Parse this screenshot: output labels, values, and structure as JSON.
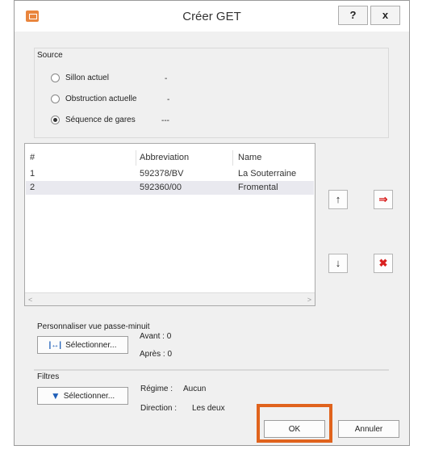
{
  "window": {
    "title": "Créer GET",
    "help_label": "?",
    "close_label": "x"
  },
  "source": {
    "label": "Source",
    "options": [
      {
        "label": "Sillon actuel",
        "value": "-",
        "selected": false
      },
      {
        "label": "Obstruction actuelle",
        "value": "-",
        "selected": false
      },
      {
        "label": "Séquence de gares",
        "value": "---",
        "selected": true
      }
    ]
  },
  "table": {
    "columns": [
      "#",
      "Abbreviation",
      "Name"
    ],
    "rows": [
      {
        "num": "1",
        "abbr": "592378/BV",
        "name": "La Souterraine",
        "selected": false
      },
      {
        "num": "2",
        "abbr": "592360/00",
        "name": "Fromental",
        "selected": true
      }
    ],
    "scroll_left": "<",
    "scroll_right": ">"
  },
  "side_buttons": {
    "up": "↑",
    "down": "↓",
    "insert": "⇒",
    "delete": "✖"
  },
  "passe_minuit": {
    "label": "Personnaliser vue passe-minuit",
    "button": "Sélectionner...",
    "avant": "Avant : 0",
    "apres": "Après : 0"
  },
  "filtres": {
    "label": "Filtres",
    "button": "Sélectionner...",
    "regime_label": "Régime :",
    "regime_value": "Aucun",
    "direction_label": "Direction :",
    "direction_value": "Les deux"
  },
  "footer": {
    "ok": "OK",
    "cancel": "Annuler"
  },
  "colors": {
    "highlight": "#e0631d",
    "selected_row": "#e9e9ef",
    "red_icon": "#d9201f",
    "filter_icon": "#1f5fb8"
  }
}
